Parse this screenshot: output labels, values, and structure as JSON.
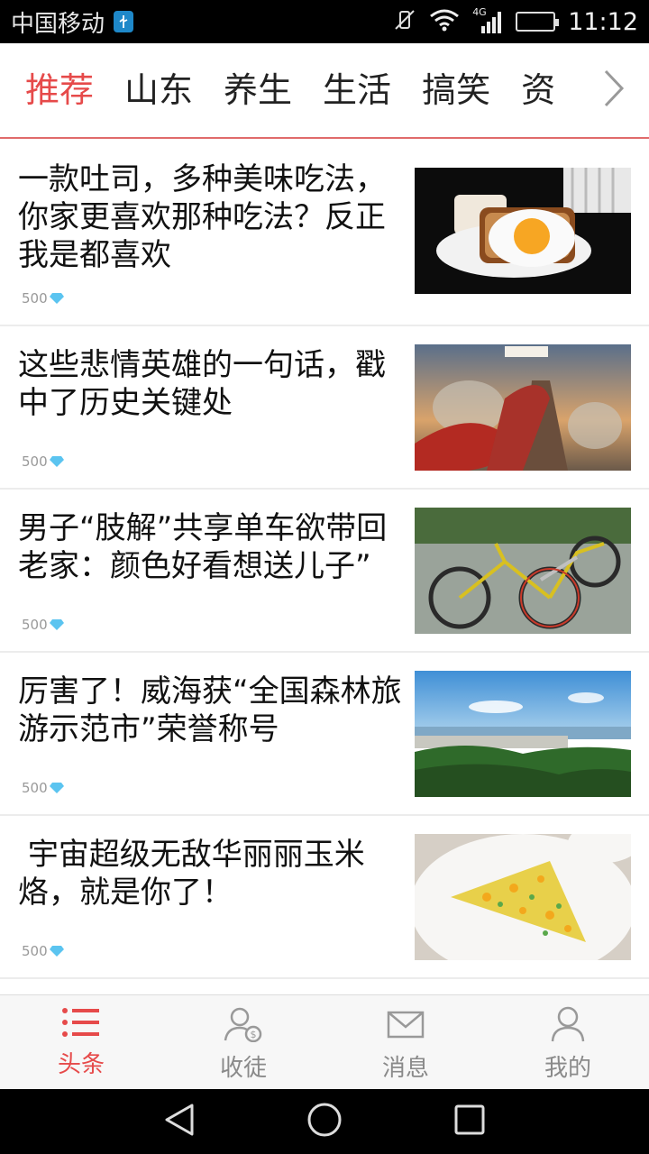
{
  "status_bar": {
    "carrier": "中国移动",
    "network": "4G",
    "time": "11:12"
  },
  "tabs": [
    {
      "label": "推荐",
      "active": true
    },
    {
      "label": "山东",
      "active": false
    },
    {
      "label": "养生",
      "active": false
    },
    {
      "label": "生活",
      "active": false
    },
    {
      "label": "搞笑",
      "active": false
    },
    {
      "label": "资",
      "active": false
    }
  ],
  "articles": [
    {
      "title": "一款吐司，多种美味吃法，你家更喜欢那种吃法？反正我是都喜欢",
      "coins": "500",
      "thumb": "toast-with-fried-egg"
    },
    {
      "title": "这些悲情英雄的一句话，戳中了历史关键处",
      "coins": "500",
      "thumb": "warrior-painting"
    },
    {
      "title": "男子“肢解”共享单车欲带回老家：颜色好看想送儿子”",
      "coins": "500",
      "thumb": "shared-bicycles"
    },
    {
      "title": "厉害了！威海获“全国森林旅游示范市”荣誉称号",
      "coins": "500",
      "thumb": "coastal-city-view"
    },
    {
      "title": " 宇宙超级无敌华丽丽玉米烙，就是你了！",
      "coins": "500",
      "thumb": "corn-pancake"
    }
  ],
  "bottom_nav": [
    {
      "label": "头条",
      "icon": "list-icon",
      "active": true
    },
    {
      "label": "收徒",
      "icon": "user-coin-icon",
      "active": false
    },
    {
      "label": "消息",
      "icon": "mail-icon",
      "active": false
    },
    {
      "label": "我的",
      "icon": "profile-icon",
      "active": false
    }
  ],
  "colors": {
    "accent": "#e64a4a",
    "inactive": "#8a8a8a"
  }
}
